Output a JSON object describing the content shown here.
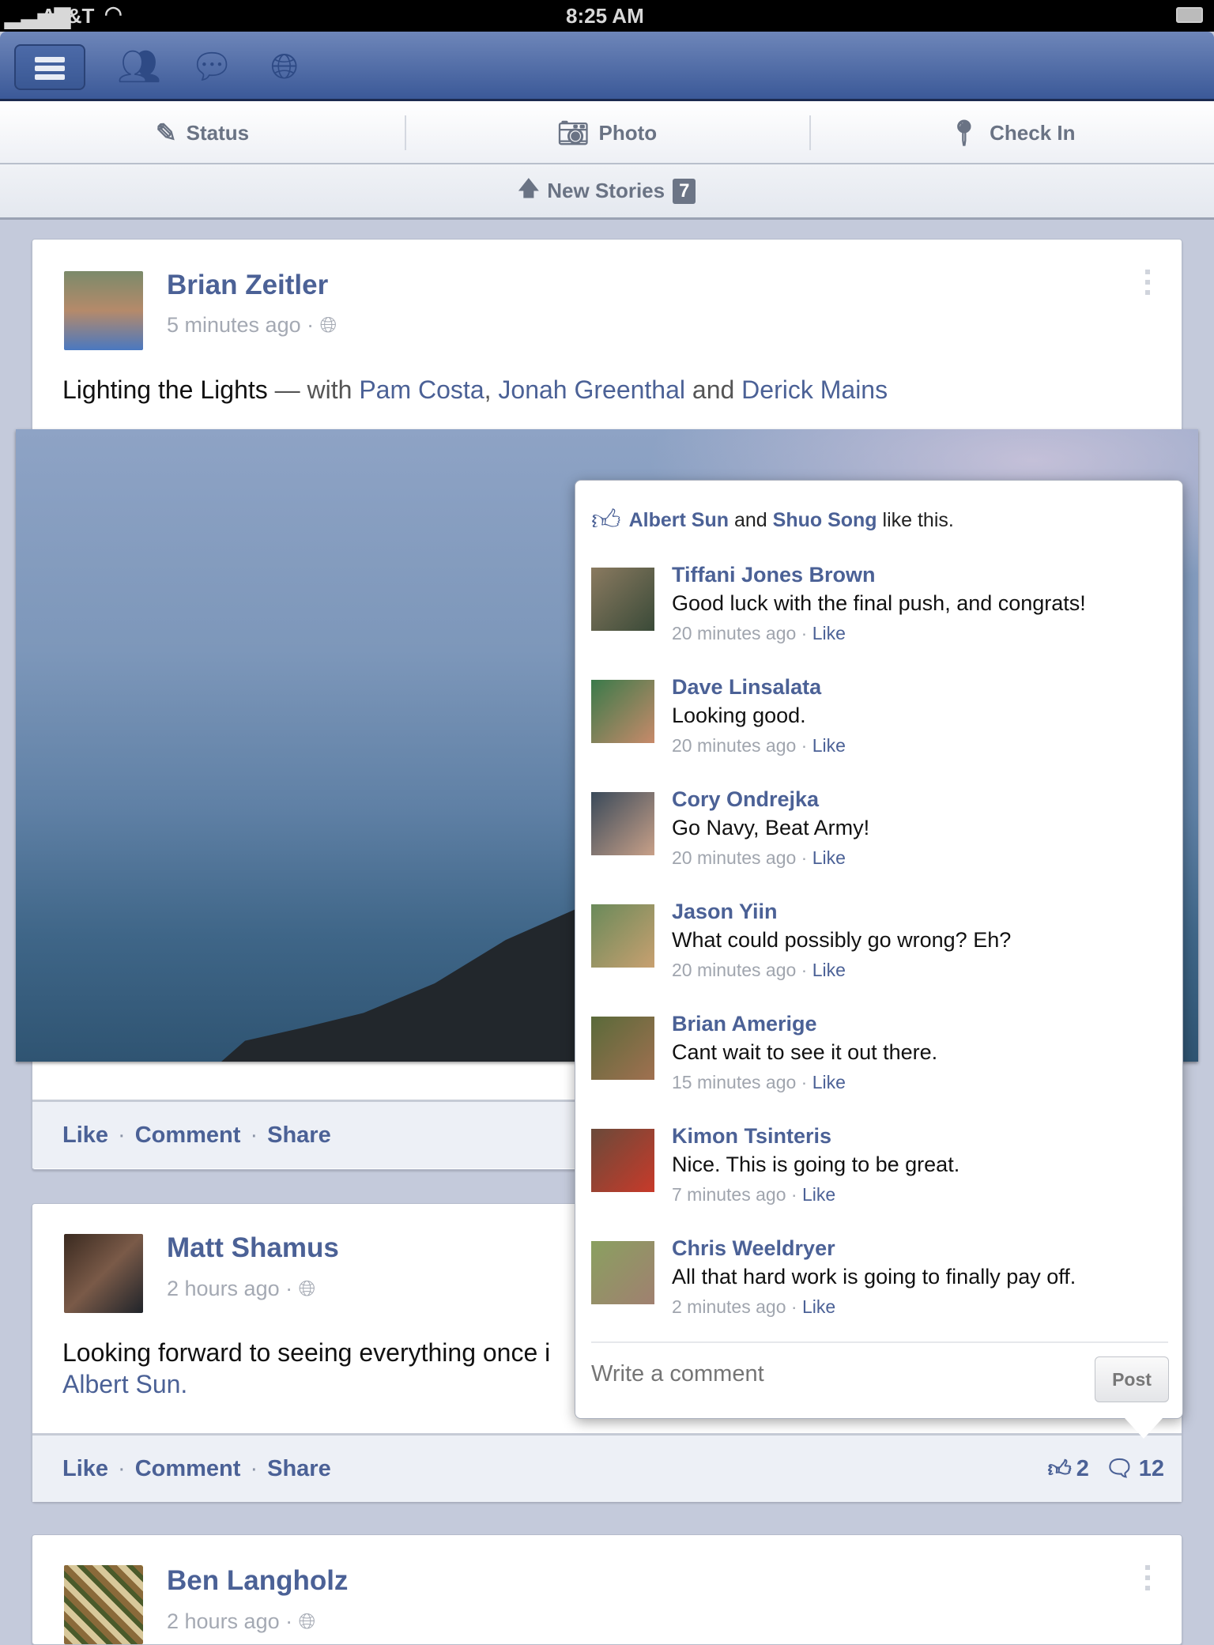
{
  "status_bar": {
    "carrier": "AT&T",
    "time": "8:25 AM"
  },
  "nav": {
    "icons": [
      "menu-icon",
      "friends-icon",
      "messages-icon",
      "notifications-globe-icon"
    ]
  },
  "composer": {
    "status": "Status",
    "photo": "Photo",
    "checkin": "Check In"
  },
  "new_stories": {
    "label": "New Stories",
    "count": "7"
  },
  "posts": [
    {
      "author": "Brian Zeitler",
      "time": "5 minutes ago",
      "text": "Lighting the Lights",
      "with_prefix": " — with ",
      "tag1": "Pam Costa",
      "sep1": ", ",
      "tag2": "Jonah Greenthal",
      "sep2": " and ",
      "tag3": "Derick Mains",
      "actions": {
        "like": "Like",
        "comment": "Comment",
        "share": "Share"
      }
    },
    {
      "author": "Matt Shamus",
      "time": "2 hours ago",
      "text": "Looking forward to seeing everything once i",
      "text2": "Albert Sun.",
      "actions": {
        "like": "Like",
        "comment": "Comment",
        "share": "Share"
      },
      "like_count": "2",
      "comment_count": "12"
    },
    {
      "author": "Ben Langholz",
      "time": "2 hours ago"
    }
  ],
  "popup": {
    "likes": {
      "user1": "Albert Sun",
      "and": " and ",
      "user2": "Shuo Song",
      "suffix": " like this."
    },
    "comments": [
      {
        "name": "Tiffani Jones Brown",
        "text": "Good luck with the final push, and congrats!",
        "time": "20 minutes ago",
        "like": "Like"
      },
      {
        "name": "Dave Linsalata",
        "text": "Looking good.",
        "time": "20 minutes ago",
        "like": "Like"
      },
      {
        "name": "Cory Ondrejka",
        "text": "Go Navy, Beat Army!",
        "time": "20 minutes ago",
        "like": "Like"
      },
      {
        "name": "Jason Yiin",
        "text": "What could possibly go wrong? Eh?",
        "time": "20 minutes ago",
        "like": "Like"
      },
      {
        "name": "Brian Amerige",
        "text": "Cant wait to see it out there.",
        "time": "15 minutes ago",
        "like": "Like"
      },
      {
        "name": "Kimon Tsinteris",
        "text": "Nice. This is going to be great.",
        "time": "7 minutes ago",
        "like": "Like"
      },
      {
        "name": "Chris Weeldryer",
        "text": "All that hard work is going to finally pay off.",
        "time": "2 minutes ago",
        "like": "Like"
      }
    ],
    "input_placeholder": "Write a comment",
    "post_button": "Post"
  },
  "colors": {
    "brand": "#3b5998",
    "link": "#4b6196",
    "background": "#c4cadb"
  }
}
